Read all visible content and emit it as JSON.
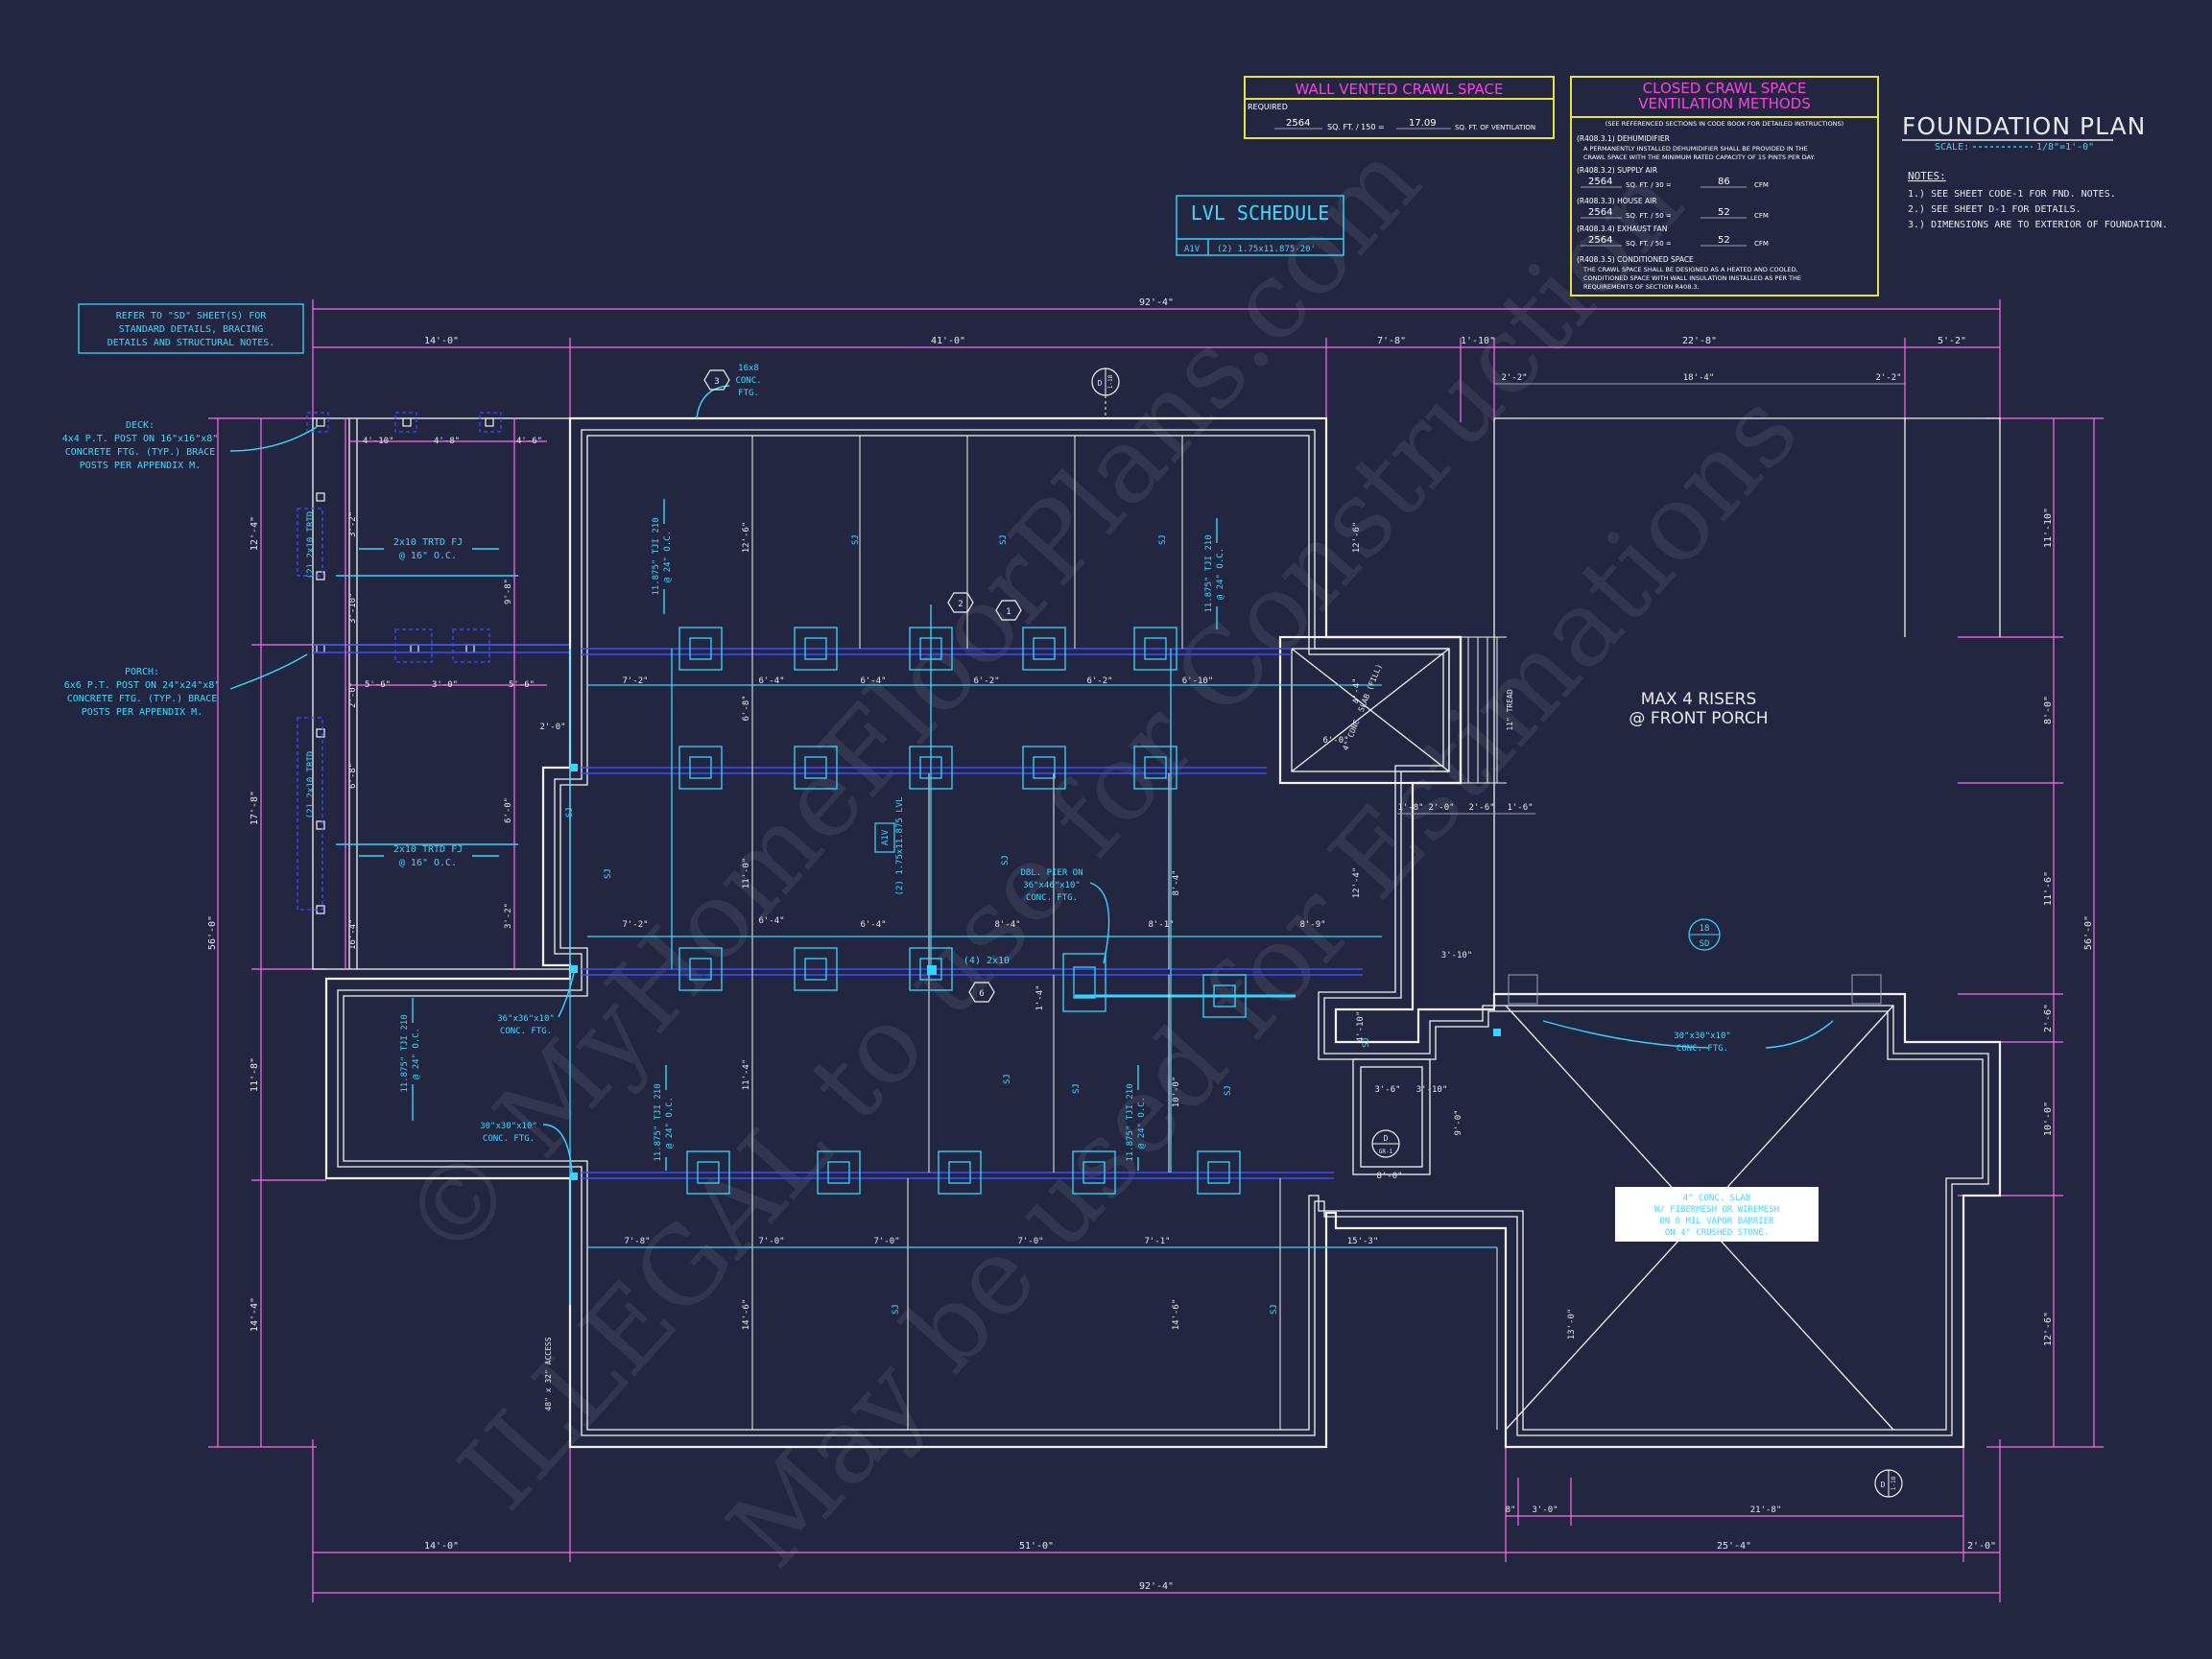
{
  "title_block": {
    "title": "FOUNDATION PLAN",
    "scale_label": "SCALE:",
    "scale_value": "1/8\"=1'-0\"",
    "notes_heading": "NOTES:",
    "notes": [
      "1.) SEE SHEET CODE-1 FOR FND. NOTES.",
      "2.) SEE SHEET D-1 FOR DETAILS.",
      "3.) DIMENSIONS ARE TO EXTERIOR OF FOUNDATION."
    ]
  },
  "wall_vented_table": {
    "title": "WALL VENTED CRAWL SPACE",
    "required_label": "REQUIRED",
    "area": "2564",
    "divisor": "SQ. FT. / 150 =",
    "result": "17.09",
    "result_unit": "SQ. FT. OF VENTILATION"
  },
  "closed_crawl_table": {
    "title_line1": "CLOSED CRAWL SPACE",
    "title_line2": "VENTILATION METHODS",
    "subtitle": "(SEE REFERENCED SECTIONS IN CODE BOOK FOR DETAILED INSTRUCTIONS)",
    "dehumidifier_head": "(R408.3.1) DEHUMIDIFIER",
    "dehumidifier_text1": "A PERMANENTLY INSTALLED DEHUMIDIFIER SHALL BE PROVIDED IN THE",
    "dehumidifier_text2": "CRAWL SPACE WITH THE MINIMUM RATED CAPACITY OF 15 PINTS PER DAY.",
    "supply_head": "(R408.3.2) SUPPLY AIR",
    "supply_area": "2564",
    "supply_div": "SQ. FT. / 30 =",
    "supply_val": "86",
    "house_head": "(R408.3.3) HOUSE AIR",
    "house_area": "2564",
    "house_div": "SQ. FT. / 50 =",
    "house_val": "52",
    "exhaust_head": "(R408.3.4) EXHAUST FAN",
    "exhaust_area": "2564",
    "exhaust_div": "SQ. FT. / 50 =",
    "exhaust_val": "52",
    "cfm": "CFM",
    "conditioned_head": "(R408.3.5) CONDITIONED SPACE",
    "conditioned_text1": "THE CRAWL SPACE SHALL BE DESIGNED AS A HEATED AND COOLED,",
    "conditioned_text2": "CONDITIONED SPACE WITH WALL INSULATION INSTALLED AS PER THE",
    "conditioned_text3": "REQUIREMENTS OF SECTION R408.3."
  },
  "lvl_schedule": {
    "title": "LVL SCHEDULE",
    "tag": "A1V",
    "desc": "(2) 1.75x11.875-20'"
  },
  "refer_note": {
    "line1": "REFER TO \"SD\" SHEET(S) FOR",
    "line2": "STANDARD DETAILS, BRACING",
    "line3": "DETAILS AND STRUCTURAL NOTES."
  },
  "callouts": {
    "deck": [
      "DECK:",
      "4x4 P.T. POST ON 16\"x16\"x8\"",
      "CONCRETE FTG. (TYP.) BRACE",
      "POSTS PER APPENDIX M."
    ],
    "porch": [
      "PORCH:",
      "6x6 P.T. POST ON 24\"x24\"x8\"",
      "CONCRETE FTG. (TYP.) BRACE",
      "POSTS PER APPENDIX M."
    ],
    "conc_ftg_16": [
      "16x8",
      "CONC.",
      "FTG."
    ],
    "dbl_pier": [
      "DBL. PIER ON",
      "36\"x46\"x10\"",
      "CONC. FTG."
    ],
    "ftg_36": [
      "36\"x36\"x10\"",
      "CONC. FTG."
    ],
    "ftg_30a": [
      "30\"x30\"x10\"",
      "CONC. FTG."
    ],
    "ftg_30b": [
      "30\"x30\"x10\"",
      "CONC. FTG."
    ],
    "max_risers": [
      "MAX 4 RISERS",
      "@ FRONT PORCH"
    ],
    "slab": [
      "4\" CONC. SLAB",
      "W/ FIBERMESH OR WIREMESH",
      "ON 6 MIL VAPOR BARRIER",
      "ON 4\" CRUSHED STONE."
    ],
    "joist_upper": [
      "2x10 TRTD FJ",
      "@ 16\" O.C."
    ],
    "joist_lower": [
      "2x10 TRTD FJ",
      "@ 16\" O.C."
    ],
    "trtd_a": "(2) 2x10 TRTD",
    "trtd_b": "(2) 2x10 TRTD",
    "tji_left": [
      "11.875\" TJI 210",
      "@ 24\" O.C."
    ],
    "tji_mid_a": [
      "11.875\" TJI 210",
      "@ 24\" O.C."
    ],
    "tji_mid_b": [
      "11.875\" TJI 210",
      "@ 24\" O.C."
    ],
    "tji_low_a": [
      "11.875\" TJI 210",
      "@ 24\" O.C."
    ],
    "tji_low_b": [
      "11.875\" TJI 210",
      "@ 24\" O.C."
    ],
    "lvl_tag": "A1V",
    "lvl_beam": "(2) 1.75x11.875 LVL",
    "two_2x10": "(4) 2x10",
    "stoop": "4\" CONC. SLAB (FILL)",
    "tread": "11\" TREAD",
    "access": "48\" x 32\" ACCESS",
    "sj": "SJ"
  },
  "markers": {
    "m3": "3",
    "m2": "2",
    "m1": "1",
    "m6": "6",
    "sec_top_a": "D",
    "sec_top_b": "1-18",
    "sec_bot_a": "D",
    "sec_bot_b": "1-18",
    "d_gr_a": "D",
    "d_gr_b": "GR-1",
    "sd_a": "18",
    "sd_b": "SD"
  },
  "dims_top": {
    "overall": "92'-4\"",
    "a": "14'-0\"",
    "b": "41'-0\"",
    "c": "7'-8\"",
    "d": "1'-10\"",
    "e": "22'-8\"",
    "f": "5'-2\""
  },
  "dims_bottom": {
    "overall": "92'-4\"",
    "a": "14'-0\"",
    "b": "51'-0\"",
    "c": "25'-4\"",
    "d": "2'-0\"",
    "e": "8\"",
    "f": "3'-0\"",
    "g": "21'-8\""
  },
  "dims_left": [
    "12'-4\"",
    "17'-8\"",
    "11'-8\"",
    "14'-4\""
  ],
  "dims_left_overall": "56'-0\"",
  "dims_right": [
    "11'-10\"",
    "8'-0\"",
    "11'-6\"",
    "2'-6\"",
    "10'-0\"",
    "12'-6\""
  ],
  "dims_right_overall": "56'-0\"",
  "dims_interior": {
    "deck_row": [
      "4'-10\"",
      "4'-8\"",
      "4'-6\""
    ],
    "porch_row": [
      "5'-6\"",
      "3'-0\"",
      "5'-6\""
    ],
    "row1": [
      "7'-2\"",
      "6'-4\"",
      "6'-4\"",
      "6'-2\"",
      "6'-2\"",
      "6'-10\""
    ],
    "row2": [
      "7'-2\"",
      "6'-4\"",
      "6'-4\"",
      "8'-4\"",
      "8'-1\"",
      "8'-9\""
    ],
    "row3": [
      "7'-8\"",
      "7'-0\"",
      "7'-0\"",
      "7'-0\"",
      "7'-1\"",
      "15'-3\""
    ],
    "stair_row": [
      "1'-8\"",
      "2'-0\"",
      "2'-6\"",
      "1'-6\""
    ],
    "porch_top": [
      "2'-2\"",
      "18'-4\"",
      "2'-2\""
    ],
    "vert_a": [
      "12'-6\"",
      "6'-8\"",
      "11'-0\"",
      "11'-4\"",
      "14'-6\""
    ],
    "vert_b": [
      "12'-6\"",
      "8'-4\"",
      "12'-4\"",
      "10'-0\"",
      "14'-6\""
    ],
    "misc": [
      "2'-0\"",
      "2'-0\"",
      "6'-8\"",
      "3'-10\"",
      "3'-6\"",
      "3'-10\"",
      "8'-0\"",
      "9'-0\"",
      "6'-0\"",
      "13'-0\"",
      "1'-4\"",
      "4'-10\"",
      "4'-4\"",
      "3'-10\"",
      "3'-2\"",
      "16'-4\"",
      "9'-8\"",
      "6'-0\"",
      "3'-2\""
    ]
  },
  "watermark": {
    "line1": "© MyHomeFloorPlans.com",
    "line2": "ILLEGAL to use for Construction",
    "line3": "May be used for Estimations"
  },
  "colors": {
    "background": "#222640",
    "walls": "#f2f2f2",
    "dimension": "#ff6ce8",
    "structure": "#38d6ff",
    "beam": "#3a4dff",
    "table_border": "#e6e24a",
    "table_title": "#ff3fe0"
  }
}
